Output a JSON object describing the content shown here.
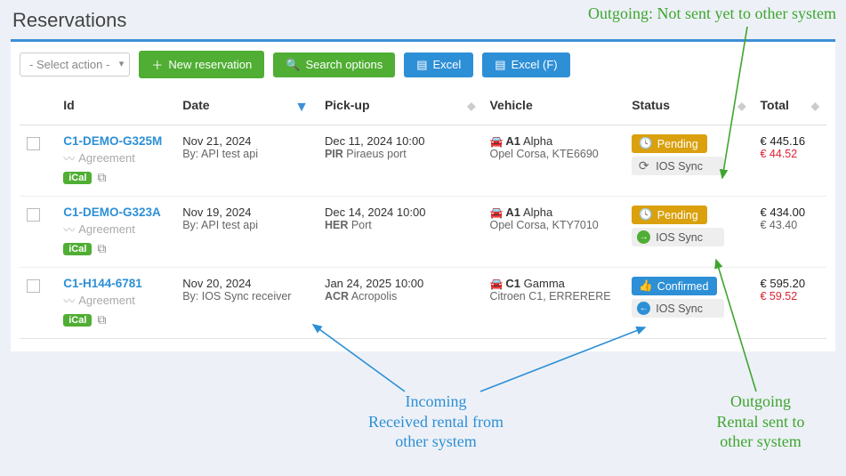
{
  "page_title": "Reservations",
  "toolbar": {
    "select_action_placeholder": "- Select action -",
    "new_reservation": "New reservation",
    "search_options": "Search options",
    "excel": "Excel",
    "excel_f": "Excel (F)"
  },
  "columns": {
    "id": "Id",
    "date": "Date",
    "pickup": "Pick-up",
    "vehicle": "Vehicle",
    "status": "Status",
    "total": "Total"
  },
  "badges": {
    "agreement": "Agreement",
    "ical": "iCal",
    "ios_sync": "IOS Sync",
    "pending": "Pending",
    "confirmed": "Confirmed"
  },
  "rows": [
    {
      "id": "C1-DEMO-G325M",
      "date": "Nov 21, 2024",
      "by": "By: API test api",
      "pickup_date": "Dec 11, 2024 10:00",
      "pickup_code": "PIR",
      "pickup_name": "Piraeus port",
      "veh_code": "A1",
      "veh_name": "Alpha",
      "veh_detail": "Opel Corsa, KTE6690",
      "status": "Pending",
      "sync_kind": "refresh",
      "total": "€ 445.16",
      "total_sub": "€ 44.52"
    },
    {
      "id": "C1-DEMO-G323A",
      "date": "Nov 19, 2024",
      "by": "By: API test api",
      "pickup_date": "Dec 14, 2024 10:00",
      "pickup_code": "HER",
      "pickup_name": "Port",
      "veh_code": "A1",
      "veh_name": "Alpha",
      "veh_detail": "Opel Corsa, KTY7010",
      "status": "Pending",
      "sync_kind": "out",
      "total": "€ 434.00",
      "total_sub": "€ 43.40",
      "total_sub_muted": true
    },
    {
      "id": "C1-H144-6781",
      "date": "Nov 20, 2024",
      "by": "By: IOS Sync receiver",
      "pickup_date": "Jan 24, 2025 10:00",
      "pickup_code": "ACR",
      "pickup_name": "Acropolis",
      "veh_code": "C1",
      "veh_name": "Gamma",
      "veh_detail": "Citroen C1, ERRERERE",
      "status": "Confirmed",
      "sync_kind": "in",
      "total": "€ 595.20",
      "total_sub": "€ 59.52"
    }
  ],
  "annotations": {
    "top_green": "Outgoing: Not sent yet to other system",
    "bottom_blue_l1": "Incoming",
    "bottom_blue_l2": "Received rental from",
    "bottom_blue_l3": "other system",
    "bottom_green_l1": "Outgoing",
    "bottom_green_l2": "Rental sent to",
    "bottom_green_l3": "other system"
  }
}
